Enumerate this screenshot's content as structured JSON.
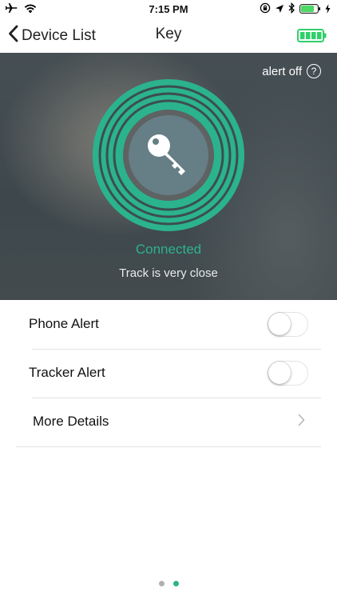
{
  "status_bar": {
    "time": "7:15 PM",
    "icons": [
      "airplane-icon",
      "wifi-icon",
      "orientation-lock-icon",
      "location-icon",
      "bluetooth-icon",
      "battery-icon",
      "charging-icon"
    ]
  },
  "nav": {
    "back_label": "Device List",
    "title": "Key",
    "tracker_battery_icon": "battery-full-icon"
  },
  "hero": {
    "alert_label": "alert off",
    "help_symbol": "?",
    "device_icon": "key-icon",
    "status": "Connected",
    "proximity": "Track is very close"
  },
  "settings": {
    "phone_alert": {
      "label": "Phone Alert",
      "enabled": false
    },
    "tracker_alert": {
      "label": "Tracker Alert",
      "enabled": false
    },
    "more_details": {
      "label": "More Details"
    }
  },
  "pager": {
    "pages": 2,
    "current": 2
  },
  "colors": {
    "accent": "#2bb38d",
    "battery_green": "#2fd06a",
    "dot_inactive": "#b0b0b0",
    "dot_active": "#2bb38d"
  }
}
